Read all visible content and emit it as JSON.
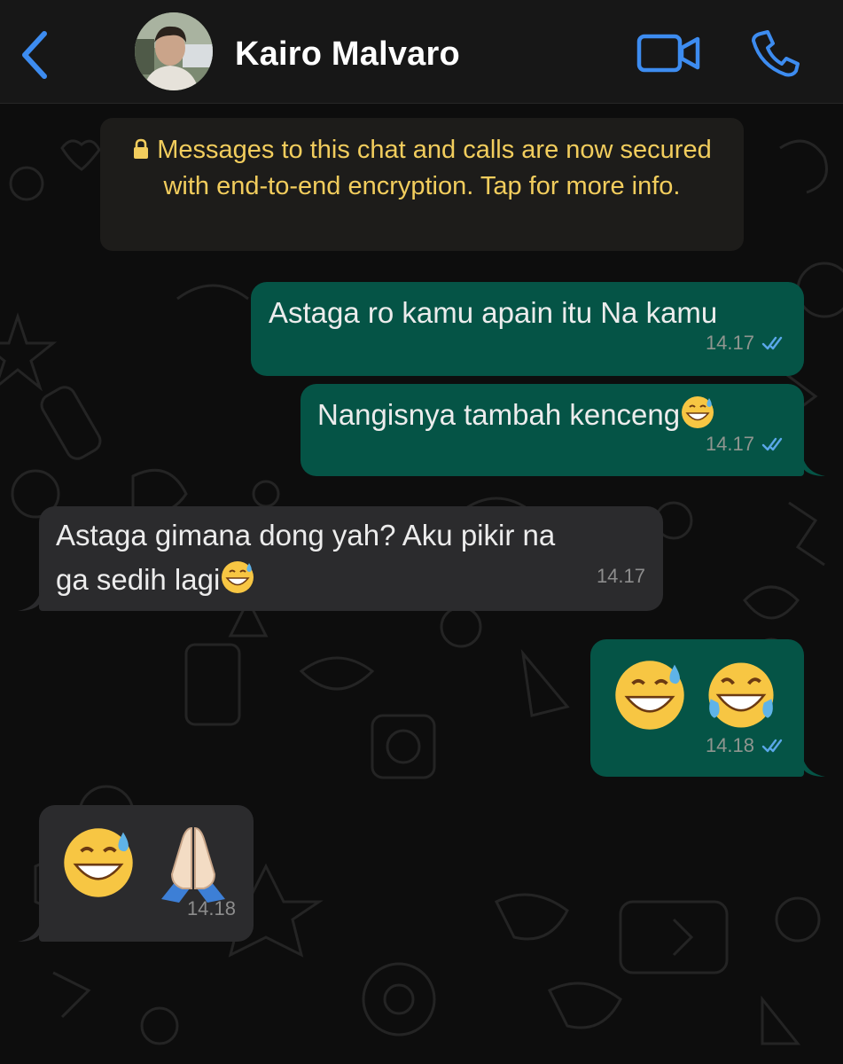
{
  "header": {
    "contact_name": "Kairo Malvaro",
    "back_icon": "chevron-left-icon",
    "video_icon": "video-camera-icon",
    "call_icon": "phone-icon",
    "accent_color": "#3d8cf0"
  },
  "notice": {
    "text": "Messages to this chat and calls are now secured with end-to-end encryption. Tap for more info.",
    "icon": "lock-icon",
    "color": "#f2cd5d"
  },
  "messages": [
    {
      "direction": "outgoing",
      "text": "Astaga ro kamu apain itu Na kamu",
      "time": "14.17",
      "status": "read"
    },
    {
      "direction": "outgoing",
      "text": "Nangisnya tambah kenceng",
      "emoji": "grinning-face-with-sweat",
      "time": "14.17",
      "status": "read"
    },
    {
      "direction": "incoming",
      "line1": "Astaga gimana dong yah? Aku pikir na",
      "line2": "ga sedih lagi",
      "emoji": "grinning-face-with-sweat",
      "time": "14.17"
    },
    {
      "direction": "outgoing",
      "emojis": [
        "grinning-face-with-sweat",
        "face-with-tears-of-joy"
      ],
      "time": "14.18",
      "status": "read"
    },
    {
      "direction": "incoming",
      "emojis": [
        "grinning-face-with-sweat",
        "folded-hands"
      ],
      "time": "14.18"
    }
  ],
  "colors": {
    "outgoing_bubble": "#055446",
    "incoming_bubble": "#2b2b2d",
    "read_tick": "#5aa7e8"
  }
}
